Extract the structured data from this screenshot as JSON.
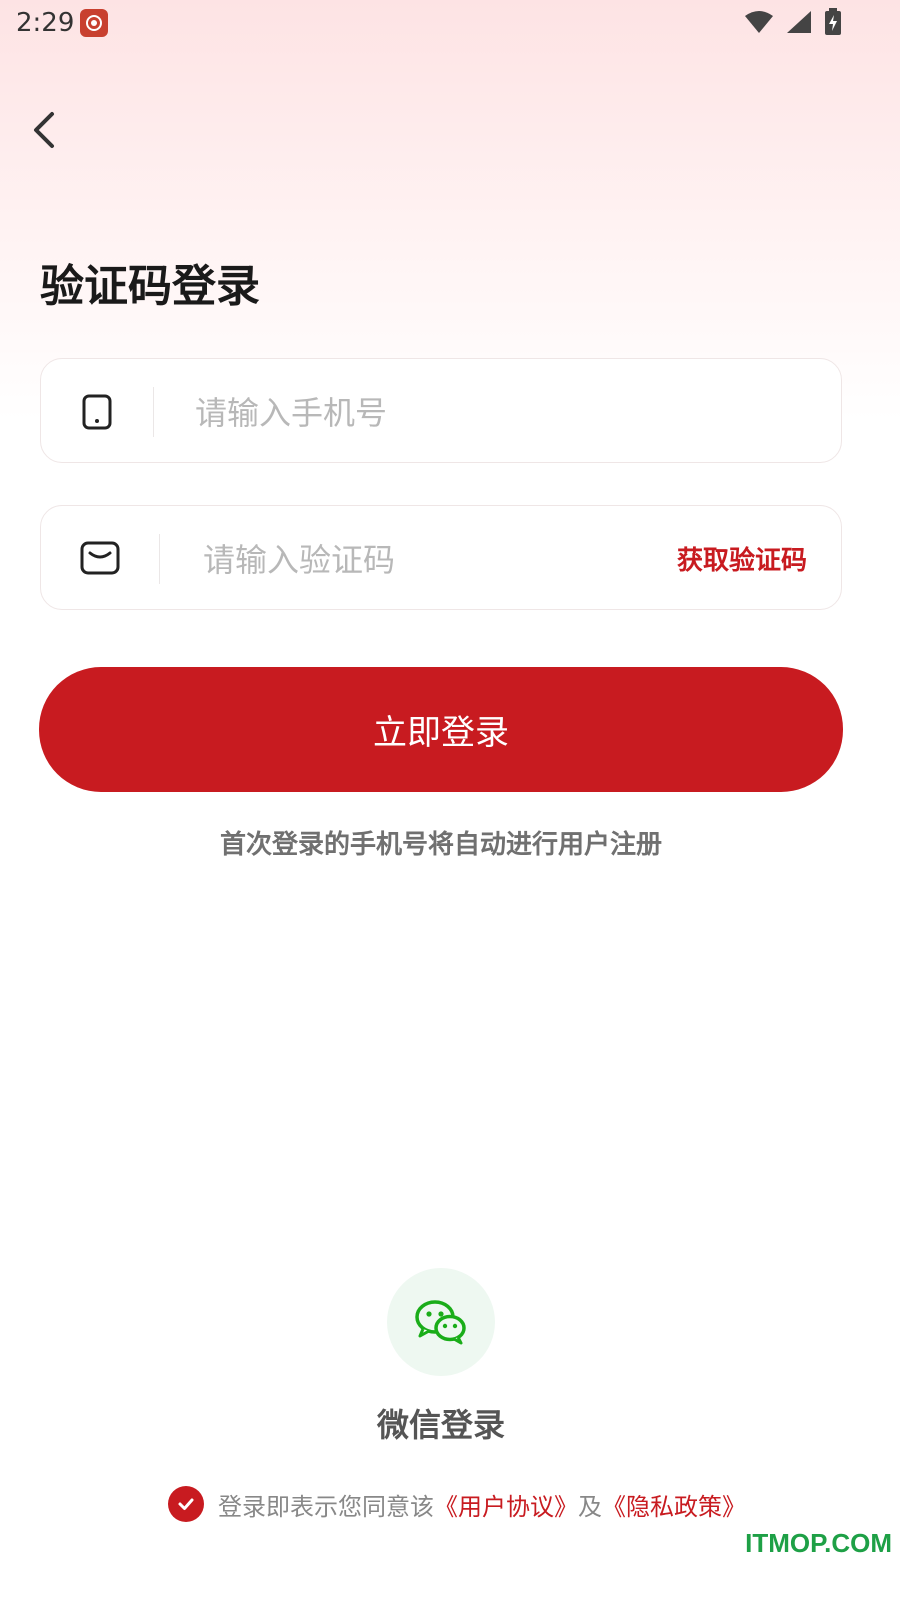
{
  "status_bar": {
    "time": "2:29"
  },
  "page": {
    "title": "验证码登录"
  },
  "phone_field": {
    "placeholder": "请输入手机号"
  },
  "code_field": {
    "placeholder": "请输入验证码",
    "get_code_label": "获取验证码"
  },
  "login_button": {
    "label": "立即登录"
  },
  "hint": "首次登录的手机号将自动进行用户注册",
  "wechat": {
    "label": "微信登录"
  },
  "agreement": {
    "prefix": "登录即表示您同意该",
    "user_agreement": "《用户协议》",
    "conjunction": "及",
    "privacy_policy": "《隐私政策》",
    "checked": true
  },
  "watermark": "ITMOP.COM",
  "colors": {
    "accent": "#c81b20",
    "wechat_green": "#1aad19"
  }
}
